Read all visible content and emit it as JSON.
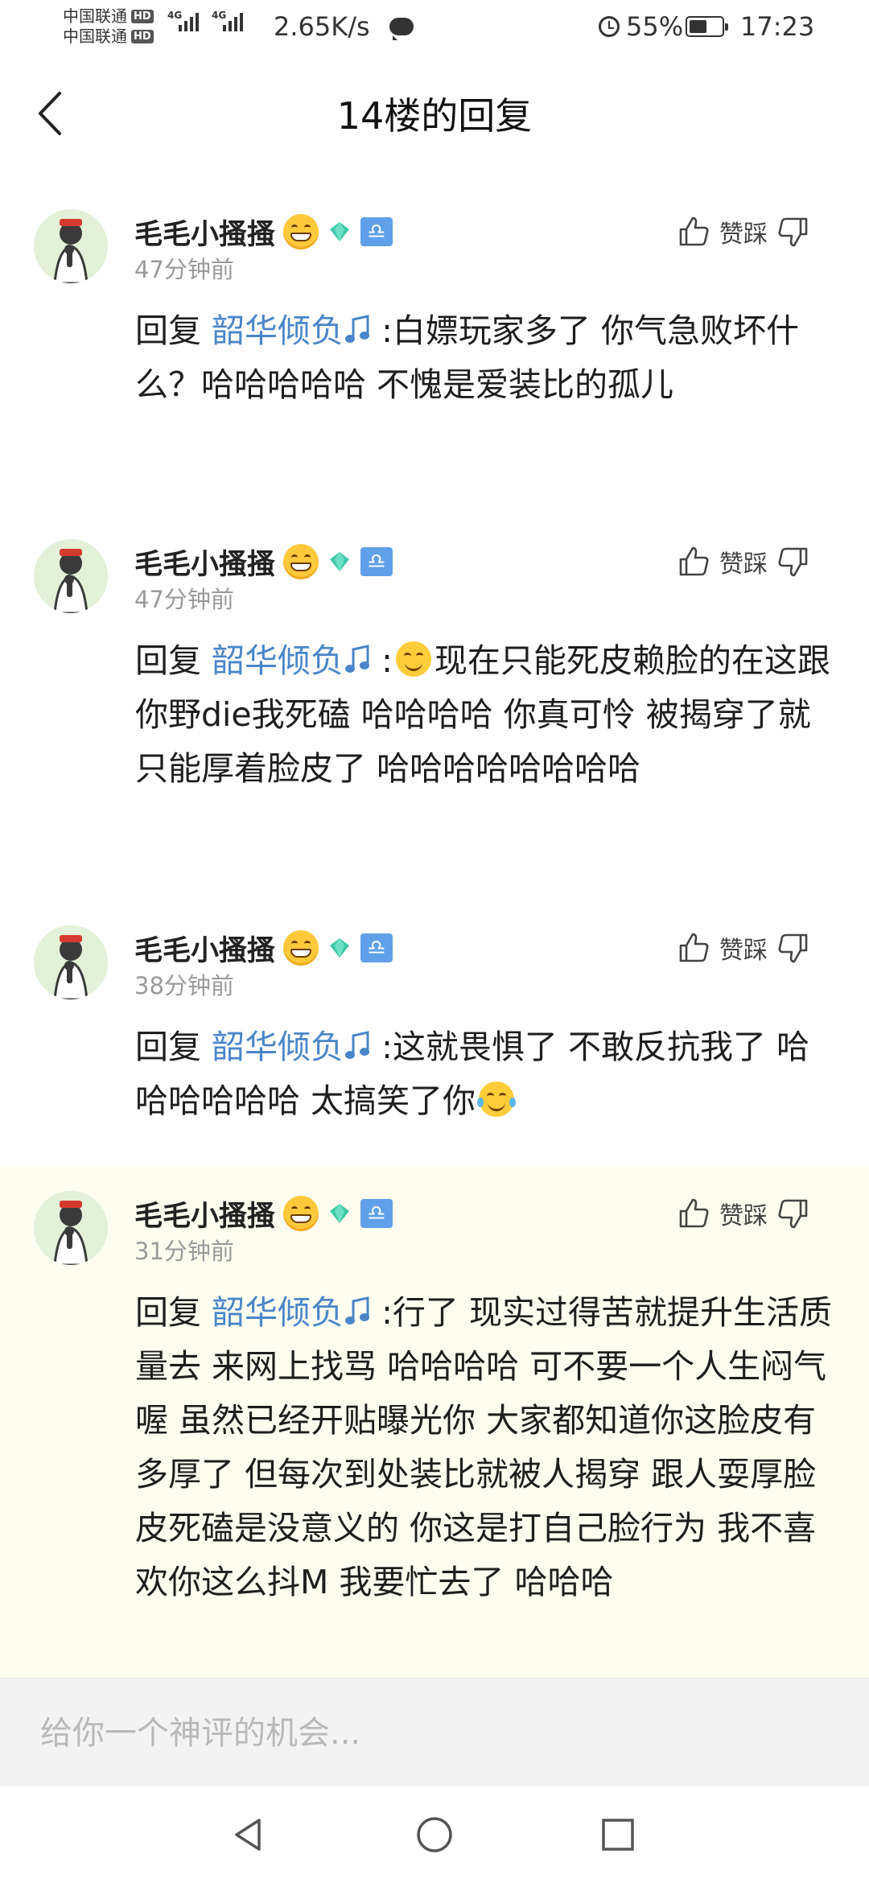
{
  "status_bar": {
    "carrier_1": "中国联通",
    "carrier_2": "中国联通",
    "hd_badge": "HD",
    "network_type_1": "4G",
    "network_type_2": "4G",
    "net_speed": "2.65K/s",
    "battery_percent": "55%",
    "battery_level": 0.55,
    "time": "17:23",
    "icons": [
      "message-bubble-icon",
      "alarm-icon",
      "battery-icon"
    ]
  },
  "header": {
    "title": "14楼的回复",
    "back_icon": "chevron-left-icon"
  },
  "comments": [
    {
      "username": "毛毛小搔搔",
      "time": "47分钟前",
      "reply_prefix": "回复 ",
      "mention": "韶华倾负",
      "text_segments": [
        ":白嫖玩家多了 你气急败坏什么？哈哈哈哈哈 不愧是爱装比的孤儿"
      ],
      "like_label": "赞踩"
    },
    {
      "username": "毛毛小搔搔",
      "time": "47分钟前",
      "reply_prefix": "回复 ",
      "mention": "韶华倾负",
      "text_segments": [
        ":",
        "现在只能死皮赖脸的在这跟你野die我死磕 哈哈哈哈 你真可怜 被揭穿了就只能厚着脸皮了 哈哈哈哈哈哈哈哈"
      ],
      "like_label": "赞踩"
    },
    {
      "username": "毛毛小搔搔",
      "time": "38分钟前",
      "reply_prefix": "回复 ",
      "mention": "韶华倾负",
      "text_segments": [
        ":这就畏惧了 不敢反抗我了 哈哈哈哈哈哈 太搞笑了你"
      ],
      "like_label": "赞踩"
    },
    {
      "username": "毛毛小搔搔",
      "time": "31分钟前",
      "reply_prefix": "回复 ",
      "mention": "韶华倾负",
      "text_segments": [
        ":行了 现实过得苦就提升生活质量去 来网上找骂 哈哈哈哈 可不要一个人生闷气喔 虽然已经开贴曝光你 大家都知道你这脸皮有多厚了 但每次到处装比就被人揭穿 跟人耍厚脸皮死磕是没意义的 你这是打自己脸行为 我不喜欢你这么抖M 我要忙去了 哈哈哈"
      ],
      "like_label": "赞踩"
    }
  ],
  "colors": {
    "mention": "#4a86c9",
    "highlight_bg": "#fdfdf0",
    "libra_badge": "#5fa0e8",
    "gem_badge": "#3ec9a7"
  },
  "input": {
    "placeholder": "给你一个神评的机会..."
  },
  "nav_bar": {
    "icons": [
      "back-triangle-icon",
      "home-circle-icon",
      "recents-square-icon"
    ]
  }
}
